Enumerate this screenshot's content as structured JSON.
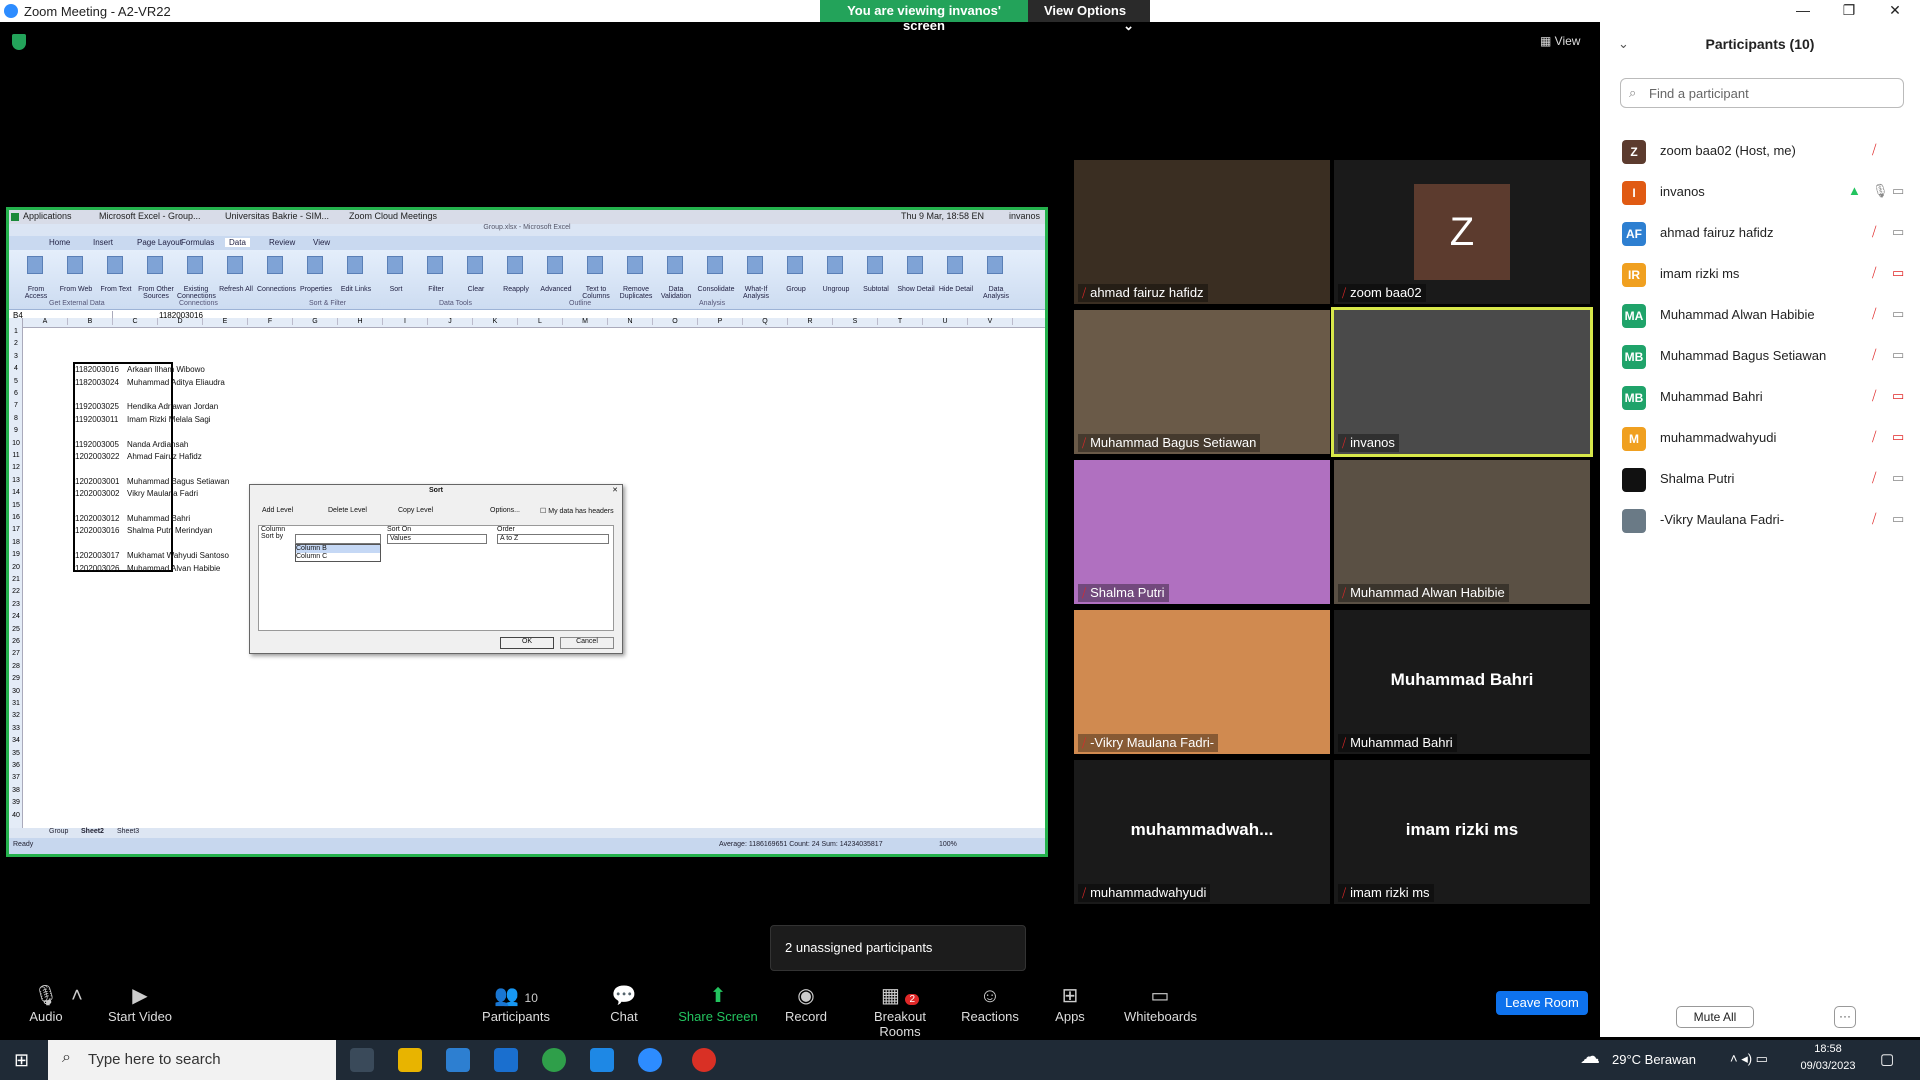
{
  "window": {
    "title": "Zoom Meeting - A2-VR22",
    "viewing": "You are viewing invanos' screen",
    "view_options": "View Options",
    "view_label": "View"
  },
  "shared_screen": {
    "vm_tabs": [
      "Applications",
      "Microsoft Excel - Group...",
      "Universitas Bakrie - SIM...",
      "Zoom Cloud Meetings"
    ],
    "vm_clock": "Thu  9 Mar, 18:58  EN",
    "vm_user": "invanos",
    "excel_title": "Group.xlsx - Microsoft Excel",
    "ribbon_tabs": [
      "Home",
      "Insert",
      "Page Layout",
      "Formulas",
      "Data",
      "Review",
      "View"
    ],
    "ribbon_groups": [
      "Get External Data",
      "Connections",
      "Sort & Filter",
      "Data Tools",
      "Outline",
      "Analysis"
    ],
    "ribbon_buttons": [
      "From Access",
      "From Web",
      "From Text",
      "From Other Sources",
      "Existing Connections",
      "Refresh All",
      "Connections",
      "Properties",
      "Edit Links",
      "Sort",
      "Filter",
      "Clear",
      "Reapply",
      "Advanced",
      "Text to Columns",
      "Remove Duplicates",
      "Data Validation",
      "Consolidate",
      "What-If Analysis",
      "Group",
      "Ungroup",
      "Subtotal",
      "Show Detail",
      "Hide Detail",
      "Data Analysis"
    ],
    "name_box": "B4",
    "formula": "1182003016",
    "columns": [
      "A",
      "B",
      "C",
      "D",
      "E",
      "F",
      "G",
      "H",
      "I",
      "J",
      "K",
      "L",
      "M",
      "N",
      "O",
      "P",
      "Q",
      "R",
      "S",
      "T",
      "U",
      "V"
    ],
    "rows": [
      {
        "r": 4,
        "id": "1182003016",
        "name": "Arkaan Ilham Wibowo"
      },
      {
        "r": 5,
        "id": "1182003024",
        "name": "Muhammad Aditya Eliaudra"
      },
      {
        "r": 7,
        "id": "1192003025",
        "name": "Hendika Adriawan Jordan"
      },
      {
        "r": 8,
        "id": "1192003011",
        "name": "Imam Rizki Melala Sagi"
      },
      {
        "r": 10,
        "id": "1192003005",
        "name": "Nanda Ardiansah"
      },
      {
        "r": 11,
        "id": "1202003022",
        "name": "Ahmad Fairuz Hafidz"
      },
      {
        "r": 13,
        "id": "1202003001",
        "name": "Muhammad Bagus Setiawan"
      },
      {
        "r": 14,
        "id": "1202003002",
        "name": "Vikry Maulana Fadri"
      },
      {
        "r": 16,
        "id": "1202003012",
        "name": "Muhammad Bahri"
      },
      {
        "r": 17,
        "id": "1202003016",
        "name": "Shalma Putri Merindyan"
      },
      {
        "r": 19,
        "id": "1202003017",
        "name": "Mukhamat Wahyudi Santoso"
      },
      {
        "r": 20,
        "id": "1202003026",
        "name": "Muhammad Alvan Habibie"
      }
    ],
    "sheets": [
      "Group",
      "Sheet2",
      "Sheet3"
    ],
    "status_ready": "Ready",
    "status_stats": "Average: 1186169651    Count: 24    Sum: 14234035817",
    "zoom_pct": "100%",
    "sort_dialog": {
      "title": "Sort",
      "add_level": "Add Level",
      "delete_level": "Delete Level",
      "copy_level": "Copy Level",
      "options": "Options...",
      "headers": "My data has headers",
      "col_header": "Column",
      "sorton_header": "Sort On",
      "order_header": "Order",
      "sort_by": "Sort by",
      "sort_on_value": "Values",
      "order_value": "A to Z",
      "dropdown_items": [
        "Column B",
        "Column C"
      ],
      "ok": "OK",
      "cancel": "Cancel"
    }
  },
  "videos": [
    {
      "name": "ahmad fairuz hafidz"
    },
    {
      "name": "zoom baa02",
      "avatar": "Z"
    },
    {
      "name": "Muhammad Bagus Setiawan"
    },
    {
      "name": "invanos"
    },
    {
      "name": "Shalma Putri"
    },
    {
      "name": "Muhammad Alwan Habibie"
    },
    {
      "name": "-Vikry Maulana Fadri-"
    },
    {
      "name": "Muhammad Bahri",
      "big": "Muhammad Bahri"
    },
    {
      "name": "muhammadwahyudi",
      "big": "muhammadwah..."
    },
    {
      "name": "imam rizki ms",
      "big": "imam rizki ms"
    }
  ],
  "participants_panel": {
    "title": "Participants (10)",
    "search_placeholder": "Find a participant",
    "list": [
      {
        "initials": "Z",
        "name": "zoom baa02 (Host, me)",
        "color": "#5c3b2e"
      },
      {
        "initials": "I",
        "name": "invanos",
        "color": "#e05a13"
      },
      {
        "initials": "AF",
        "name": "ahmad fairuz hafidz",
        "color": "#2d7fd1"
      },
      {
        "initials": "IR",
        "name": "imam rizki ms",
        "color": "#f0a020"
      },
      {
        "initials": "MA",
        "name": "Muhammad Alwan Habibie",
        "color": "#1fa36a"
      },
      {
        "initials": "MB",
        "name": "Muhammad Bagus Setiawan",
        "color": "#1fa36a"
      },
      {
        "initials": "MB",
        "name": "Muhammad Bahri",
        "color": "#1fa36a"
      },
      {
        "initials": "M",
        "name": "muhammadwahyudi",
        "color": "#f0a020"
      },
      {
        "initials": "",
        "name": "Shalma Putri",
        "color": "#111111"
      },
      {
        "initials": "",
        "name": "-Vikry Maulana Fadri-",
        "color": "#6a7a86"
      }
    ],
    "mute_all": "Mute All",
    "more": "···"
  },
  "toast": "2 unassigned participants",
  "toolbar": {
    "audio": "Audio",
    "start_video": "Start Video",
    "participants": "Participants",
    "participants_count": "10",
    "chat": "Chat",
    "share_screen": "Share Screen",
    "record": "Record",
    "breakout": "Breakout Rooms",
    "breakout_badge": "2",
    "reactions": "Reactions",
    "apps": "Apps",
    "whiteboards": "Whiteboards",
    "leave": "Leave Room"
  },
  "taskbar": {
    "search_placeholder": "Type here to search",
    "weather": "29°C  Berawan",
    "time": "18:58",
    "date": "09/03/2023"
  }
}
